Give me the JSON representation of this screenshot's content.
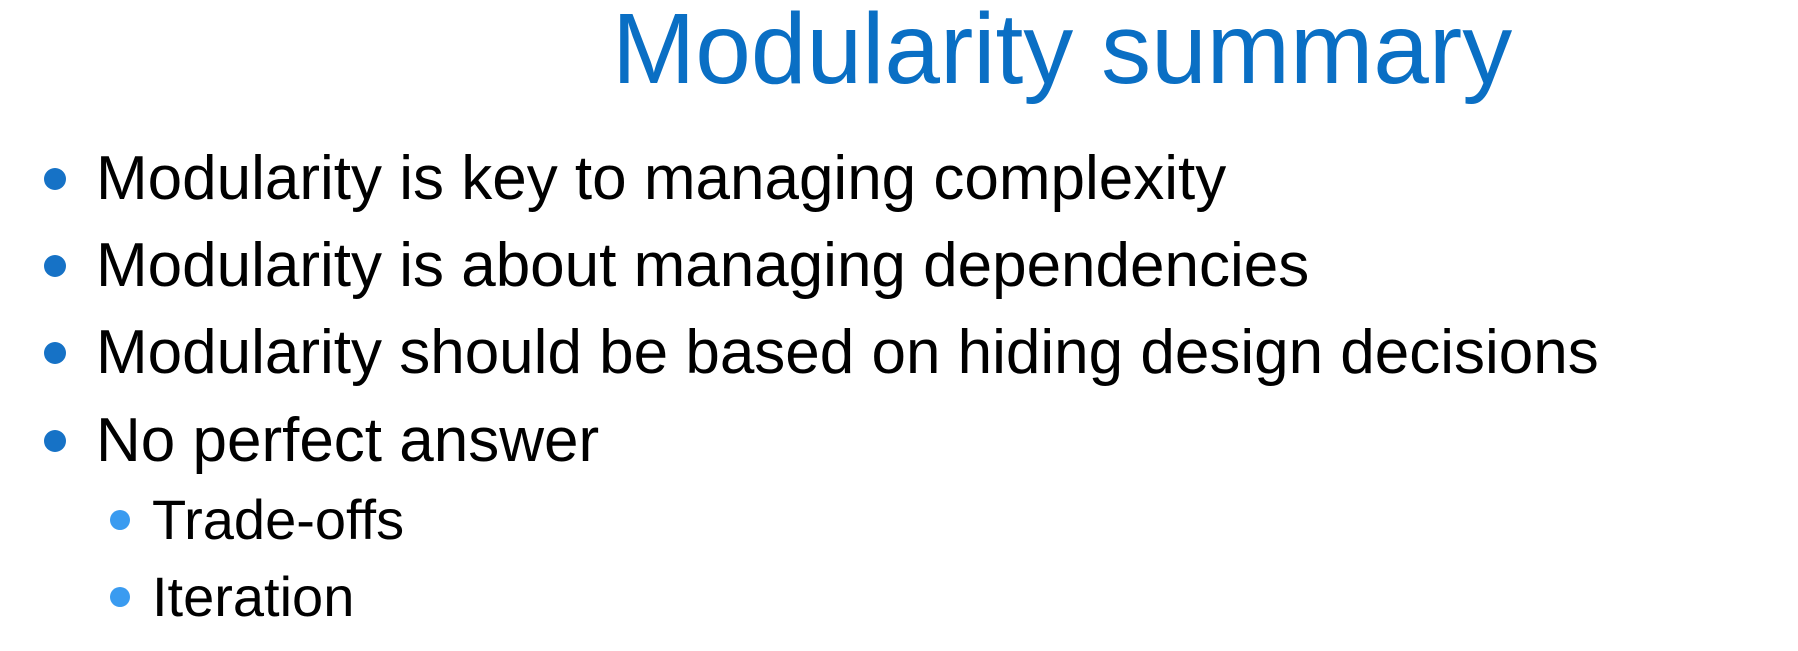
{
  "slide": {
    "title": "Modularity summary",
    "bullets": [
      "Modularity is key to managing complexity",
      "Modularity is about managing dependencies",
      "Modularity should be based on hiding design decisions",
      "No perfect answer"
    ],
    "sub_bullets": [
      "Trade-offs",
      "Iteration"
    ]
  },
  "colors": {
    "title": "#0A6FC4",
    "bullet_dot": "#1672C6",
    "sub_bullet_dot": "#3A9BF0",
    "text": "#000000",
    "background": "#FFFFFF"
  }
}
